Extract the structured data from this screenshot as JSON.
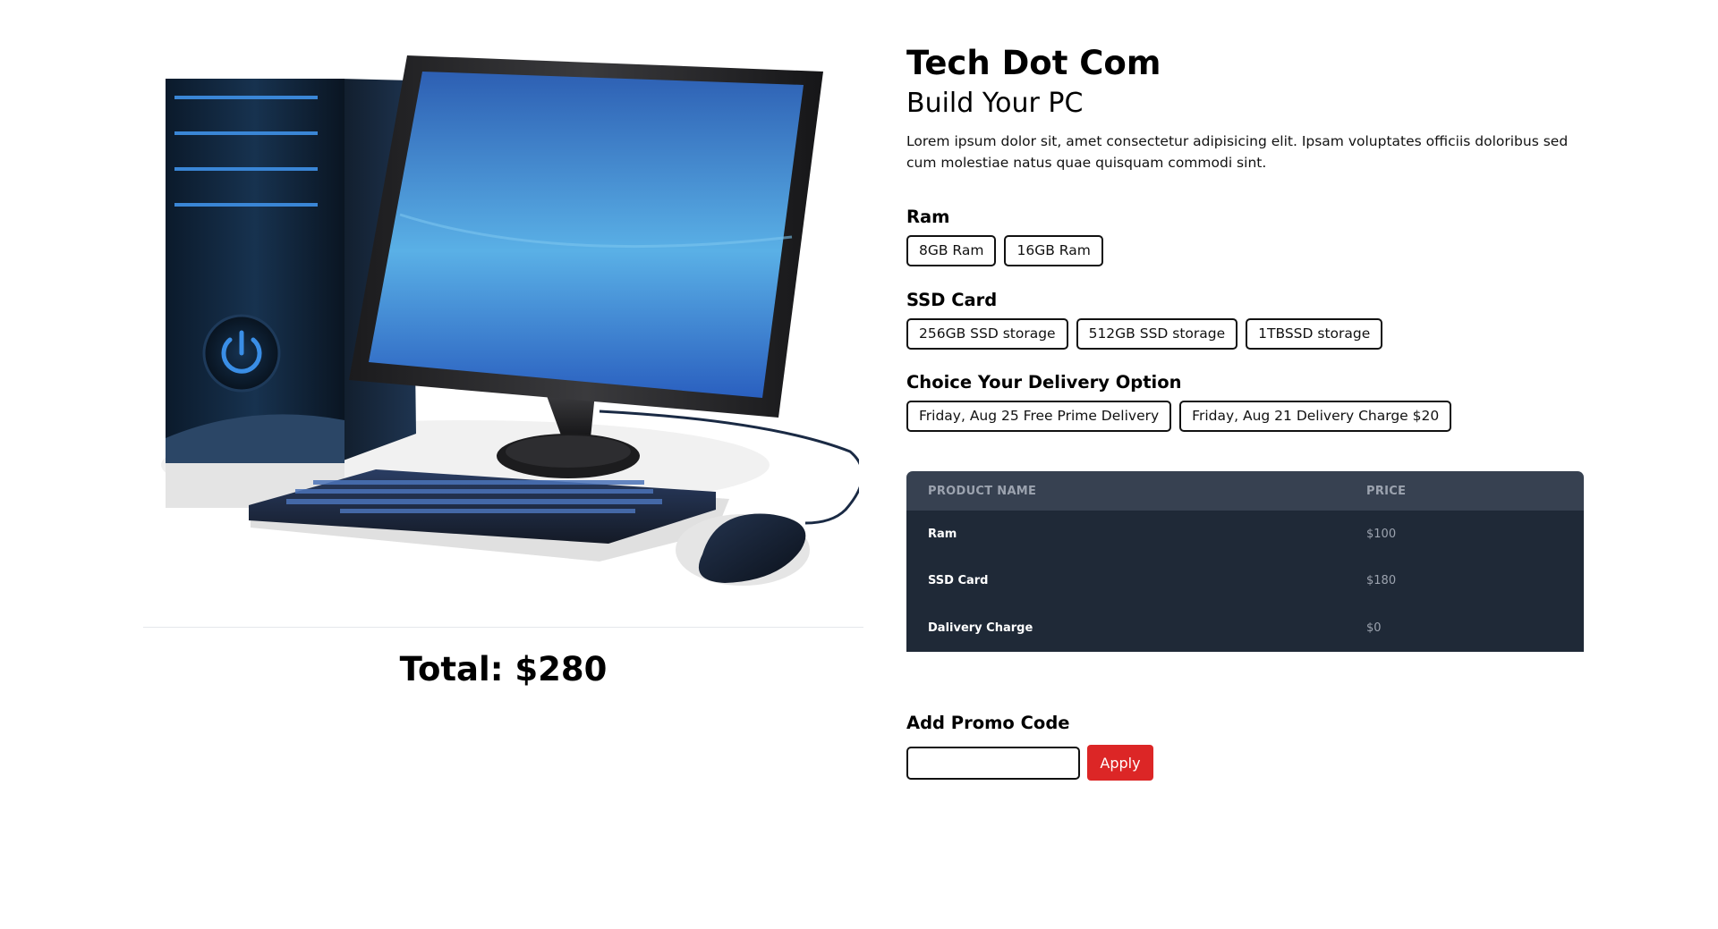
{
  "store": {
    "title": "Tech Dot Com",
    "subtitle": "Build Your PC",
    "description": "Lorem ipsum dolor sit, amet consectetur adipisicing elit. Ipsam voluptates officiis doloribus sed cum molestiae natus quae quisquam commodi sint."
  },
  "options": {
    "ram": {
      "label": "Ram",
      "items": [
        "8GB Ram",
        "16GB Ram"
      ]
    },
    "ssd": {
      "label": "SSD Card",
      "items": [
        "256GB SSD storage",
        "512GB SSD storage",
        "1TBSSD storage"
      ]
    },
    "delivery": {
      "label": "Choice Your Delivery Option",
      "items": [
        "Friday, Aug 25 Free Prime Delivery",
        "Friday, Aug 21 Delivery Charge $20"
      ]
    }
  },
  "summary": {
    "headers": [
      "PRODUCT NAME",
      "PRICE"
    ],
    "rows": [
      {
        "name": "Ram",
        "price": "$100"
      },
      {
        "name": "SSD Card",
        "price": "$180"
      },
      {
        "name": "Dalivery Charge",
        "price": "$0"
      }
    ]
  },
  "total": "Total: $280",
  "promo": {
    "label": "Add Promo Code",
    "input_value": "",
    "button_label": "Apply"
  },
  "colors": {
    "table_header": "#374151",
    "table_body": "#1f2937",
    "apply_button": "#dc2626"
  },
  "icons": [
    "power-icon"
  ]
}
